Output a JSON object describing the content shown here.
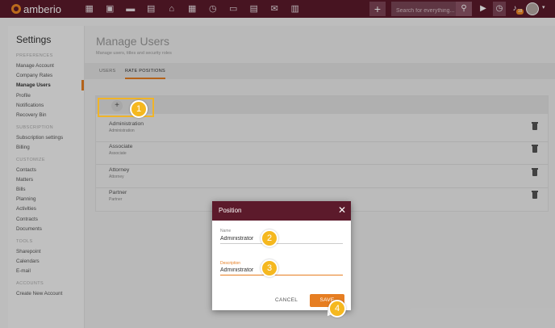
{
  "topbar": {
    "logo": "amberio",
    "nav_icons": [
      "dashboard-icon",
      "contacts-icon",
      "briefcase-icon",
      "document-icon",
      "bank-icon",
      "calendar-icon",
      "clock-icon",
      "folder-icon",
      "doc-edit-icon",
      "mail-icon",
      "chart-icon"
    ],
    "search_placeholder": "Search for everything...",
    "badge_count": "18"
  },
  "sidebar": {
    "title": "Settings",
    "sections": [
      {
        "header": "PREFERENCES",
        "items": [
          "Manage Account",
          "Company Rates",
          "Manage Users",
          "Profile",
          "Notifications",
          "Recovery Bin"
        ]
      },
      {
        "header": "SUBSCRIPTION",
        "items": [
          "Subscription settings",
          "Billing"
        ]
      },
      {
        "header": "CUSTOMIZE",
        "items": [
          "Contacts",
          "Matters",
          "Bills",
          "Planning",
          "Activities",
          "Contracts",
          "Documents"
        ]
      },
      {
        "header": "TOOLS",
        "items": [
          "Sharepoint",
          "Calendars",
          "E-mail"
        ]
      },
      {
        "header": "ACCOUNTS",
        "items": [
          "Create New Account"
        ]
      }
    ],
    "active_item": "Manage Users"
  },
  "main": {
    "title": "Manage Users",
    "subtitle": "Manage users, titles and security roles",
    "tabs": [
      "USERS",
      "RATE POSITIONS"
    ],
    "active_tab": "RATE POSITIONS",
    "add_symbol": "+",
    "positions": [
      {
        "name": "Administration",
        "desc": "Administration"
      },
      {
        "name": "Associate",
        "desc": "Associate"
      },
      {
        "name": "Attorney",
        "desc": "Attorney"
      },
      {
        "name": "Partner",
        "desc": "Partner"
      }
    ]
  },
  "dialog": {
    "title": "Position",
    "close": "✕",
    "name_label": "Name",
    "name_value": "Administrator",
    "desc_label": "Description",
    "desc_value": "Administrator",
    "cancel": "CANCEL",
    "save": "SAVE"
  },
  "steps": [
    "1",
    "2",
    "3",
    "4"
  ],
  "colors": {
    "brand": "#5c1a2b",
    "accent": "#e67e22",
    "step": "#f5b81f"
  }
}
